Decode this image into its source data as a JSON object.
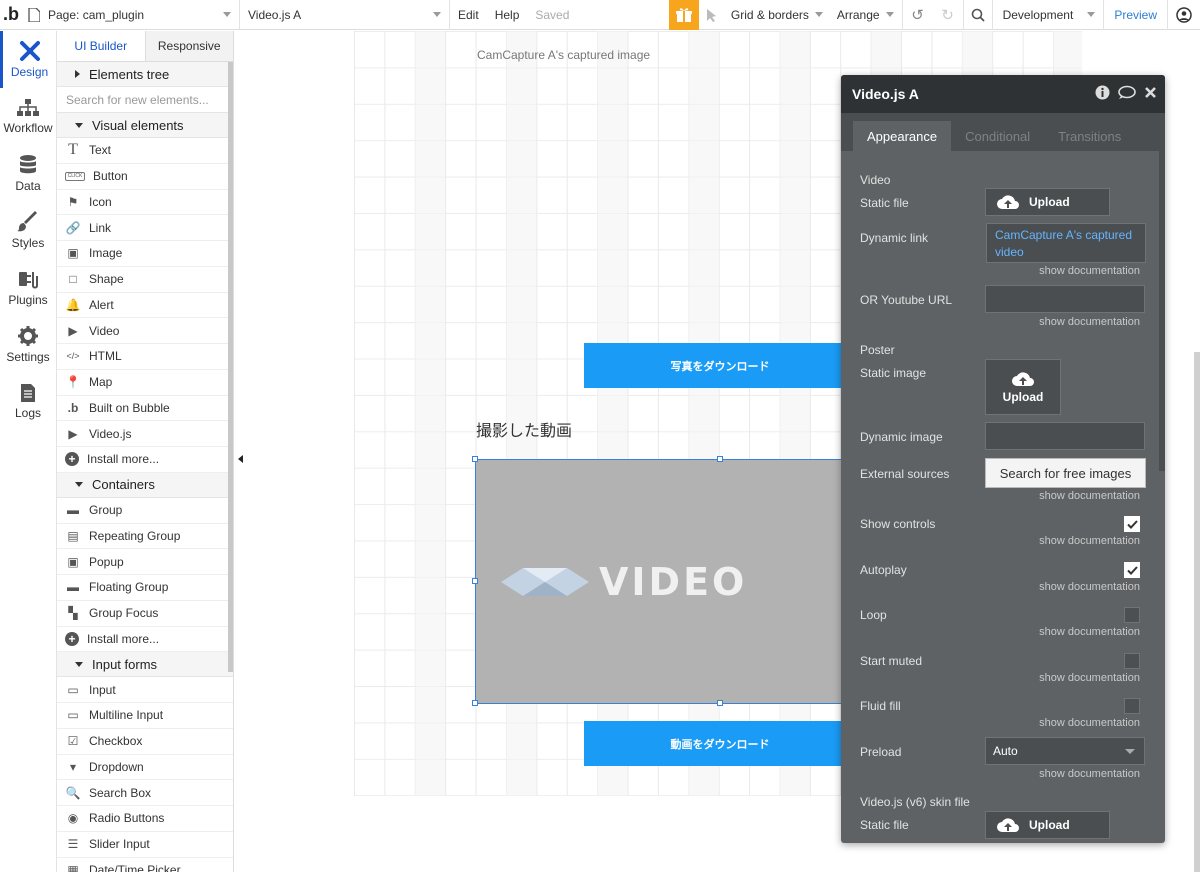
{
  "topbar": {
    "logo": ".b",
    "page_label": "Page: cam_plugin",
    "element_label": "Video.js A",
    "edit": "Edit",
    "help": "Help",
    "saved": "Saved",
    "grid": "Grid & borders",
    "arrange": "Arrange",
    "environment": "Development",
    "preview": "Preview",
    "accent": "#f7a51c"
  },
  "leftnav": [
    {
      "label": "Design",
      "icon": "design-icon",
      "active": true
    },
    {
      "label": "Workflow",
      "icon": "workflow-icon"
    },
    {
      "label": "Data",
      "icon": "database-icon"
    },
    {
      "label": "Styles",
      "icon": "brush-icon"
    },
    {
      "label": "Plugins",
      "icon": "plug-icon"
    },
    {
      "label": "Settings",
      "icon": "gear-icon"
    },
    {
      "label": "Logs",
      "icon": "document-icon"
    }
  ],
  "palette": {
    "tabs": [
      "UI Builder",
      "Responsive"
    ],
    "elements_tree": "Elements tree",
    "search_placeholder": "Search for new elements...",
    "visual_header": "Visual elements",
    "visual": [
      {
        "label": "Text",
        "icon": "T"
      },
      {
        "label": "Button",
        "icon": "CLICK"
      },
      {
        "label": "Icon",
        "icon": "⚑"
      },
      {
        "label": "Link",
        "icon": "🔗"
      },
      {
        "label": "Image",
        "icon": "▣"
      },
      {
        "label": "Shape",
        "icon": "□"
      },
      {
        "label": "Alert",
        "icon": "🔔"
      },
      {
        "label": "Video",
        "icon": "▶"
      },
      {
        "label": "HTML",
        "icon": "</>"
      },
      {
        "label": "Map",
        "icon": "📍"
      },
      {
        "label": "Built on Bubble",
        "icon": ".b"
      },
      {
        "label": "Video.js",
        "icon": "▶"
      },
      {
        "label": "Install more...",
        "icon": "+"
      }
    ],
    "containers_header": "Containers",
    "containers": [
      {
        "label": "Group",
        "icon": "▬"
      },
      {
        "label": "Repeating Group",
        "icon": "▤"
      },
      {
        "label": "Popup",
        "icon": "▣"
      },
      {
        "label": "Floating Group",
        "icon": "▬"
      },
      {
        "label": "Group Focus",
        "icon": "▚"
      },
      {
        "label": "Install more...",
        "icon": "+"
      }
    ],
    "inputs_header": "Input forms",
    "inputs": [
      {
        "label": "Input",
        "icon": "▭"
      },
      {
        "label": "Multiline Input",
        "icon": "▭"
      },
      {
        "label": "Checkbox",
        "icon": "☑"
      },
      {
        "label": "Dropdown",
        "icon": "▾"
      },
      {
        "label": "Search Box",
        "icon": "🔍"
      },
      {
        "label": "Radio Buttons",
        "icon": "◉"
      },
      {
        "label": "Slider Input",
        "icon": "☰"
      },
      {
        "label": "Date/Time Picker",
        "icon": "▦"
      }
    ]
  },
  "canvas": {
    "caption": "CamCapture A's captured image",
    "photo_button": "写真をダウンロード",
    "heading": "撮影した動画",
    "video_word": "VIDEO",
    "video_button": "動画をダウンロード"
  },
  "props": {
    "title": "Video.js A",
    "tabs": [
      "Appearance",
      "Conditional",
      "Transitions"
    ],
    "video_section": "Video",
    "static_file": "Static file",
    "upload": "Upload",
    "dynamic_link": "Dynamic link",
    "dynamic_link_value": "CamCapture A's captured video",
    "show_doc": "show documentation",
    "youtube": "OR Youtube URL",
    "poster": "Poster",
    "static_image": "Static image",
    "dynamic_image": "Dynamic image",
    "external_sources": "External sources",
    "search_free": "Search for free images",
    "show_controls": "Show controls",
    "autoplay": "Autoplay",
    "loop": "Loop",
    "start_muted": "Start muted",
    "fluid_fill": "Fluid fill",
    "preload": "Preload",
    "preload_value": "Auto",
    "skin_file": "Video.js (v6) skin file",
    "skin_static": "Static file"
  }
}
